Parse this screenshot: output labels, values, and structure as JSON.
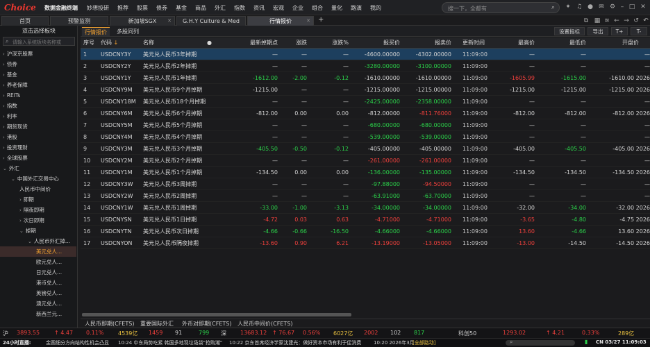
{
  "titlebar": {
    "logo": "Choice",
    "logo_sub": "数据金融终端",
    "menus": [
      "妙想投研",
      "推荐",
      "股票",
      "债券",
      "基金",
      "商品",
      "外汇",
      "指数",
      "资讯",
      "宏观",
      "企业",
      "组合",
      "量化",
      "路演",
      "我的"
    ],
    "search_placeholder": "搜一下，全都有"
  },
  "tabs": [
    {
      "label": "首页"
    },
    {
      "label": "预警监测"
    },
    {
      "label": "新加坡SGX"
    },
    {
      "label": "G.H.Y Culture & Med"
    },
    {
      "label": "行情报价"
    }
  ],
  "sidebar": {
    "title": "双击选择板块",
    "search_placeholder": "请输入系统板块名称或",
    "items": [
      {
        "label": "沪深京股票",
        "level": 0,
        "arrow": "›"
      },
      {
        "label": "债券",
        "level": 0,
        "arrow": "›"
      },
      {
        "label": "基金",
        "level": 0,
        "arrow": "›"
      },
      {
        "label": "养老保障",
        "level": 0,
        "arrow": "›"
      },
      {
        "label": "REITs",
        "level": 0,
        "arrow": "›"
      },
      {
        "label": "指数",
        "level": 0,
        "arrow": "›"
      },
      {
        "label": "利率",
        "level": 0,
        "arrow": "›"
      },
      {
        "label": "期货现货",
        "level": 0,
        "arrow": "›"
      },
      {
        "label": "港股",
        "level": 0,
        "arrow": "›"
      },
      {
        "label": "投资理财",
        "level": 0,
        "arrow": "›"
      },
      {
        "label": "全球股票",
        "level": 0,
        "arrow": "›"
      },
      {
        "label": "外汇",
        "level": 0,
        "arrow": "⌄"
      },
      {
        "label": "中国外汇交易中心",
        "level": 1,
        "arrow": "⌄"
      },
      {
        "label": "人民币中间价",
        "level": 2,
        "arrow": ""
      },
      {
        "label": "即期",
        "level": 2,
        "arrow": "›"
      },
      {
        "label": "隔夜即期",
        "level": 2,
        "arrow": "›"
      },
      {
        "label": "次日即期",
        "level": 2,
        "arrow": "›"
      },
      {
        "label": "掉期",
        "level": 2,
        "arrow": "⌄"
      },
      {
        "label": "人民币外汇掉...",
        "level": 3,
        "arrow": "⌄"
      },
      {
        "label": "美元兑人...",
        "level": 4,
        "arrow": "",
        "selected": true
      },
      {
        "label": "欧元兑人...",
        "level": 4,
        "arrow": ""
      },
      {
        "label": "日元兑人...",
        "level": 4,
        "arrow": ""
      },
      {
        "label": "港币兑人...",
        "level": 4,
        "arrow": ""
      },
      {
        "label": "英镑兑人...",
        "level": 4,
        "arrow": ""
      },
      {
        "label": "澳元兑人...",
        "level": 4,
        "arrow": ""
      },
      {
        "label": "新西兰元...",
        "level": 4,
        "arrow": ""
      }
    ]
  },
  "subtabs": [
    "行情报价",
    "多股同列"
  ],
  "toolbar_buttons": [
    "设置指标",
    "导出",
    "T+",
    "T-"
  ],
  "table": {
    "headers": [
      "序号",
      "代码",
      "名称",
      "",
      "最新掉期点",
      "涨跌",
      "涨跌%",
      "报买价",
      "报卖价",
      "更新时间",
      "最高价",
      "最低价",
      "开盘价"
    ],
    "sort_indicator": "↓",
    "rows": [
      {
        "no": "1",
        "code": "USDCNY3Y",
        "name": "美元兑人民币3年掉期",
        "last": "—",
        "chg": "—",
        "pct": "—",
        "bid": "-4600.00000",
        "ask": "-4302.00000",
        "time": "11:09:00",
        "high": "—",
        "low": "—",
        "open": "—",
        "c_last": "gray",
        "c_chg": "gray",
        "c_bid": "gray",
        "c_ask": "gray",
        "c_high": "gray",
        "c_low": "gray",
        "c_open": "gray"
      },
      {
        "no": "2",
        "code": "USDCNY2Y",
        "name": "美元兑人民币2年掉期",
        "last": "—",
        "chg": "—",
        "pct": "—",
        "bid": "-3280.00000",
        "ask": "-3100.00000",
        "time": "11:09:00",
        "high": "—",
        "low": "—",
        "open": "—",
        "c_last": "gray",
        "c_chg": "gray",
        "c_bid": "green",
        "c_ask": "green",
        "c_high": "gray",
        "c_low": "gray",
        "c_open": "gray"
      },
      {
        "no": "3",
        "code": "USDCNY1Y",
        "name": "美元兑人民币1年掉期",
        "last": "-1612.00",
        "chg": "-2.00",
        "pct": "-0.12",
        "bid": "-1610.00000",
        "ask": "-1610.00000",
        "time": "11:09:00",
        "high": "-1605.99",
        "low": "-1615.00",
        "open": "-1610.00 2026",
        "c_last": "green",
        "c_chg": "green",
        "c_bid": "gray",
        "c_ask": "gray",
        "c_high": "red",
        "c_low": "green",
        "c_open": "gray"
      },
      {
        "no": "4",
        "code": "USDCNY9M",
        "name": "美元兑人民币9个月掉期",
        "last": "-1215.00",
        "chg": "—",
        "pct": "—",
        "bid": "-1215.00000",
        "ask": "-1215.00000",
        "time": "11:09:00",
        "high": "-1215.00",
        "low": "-1215.00",
        "open": "-1215.00 2026",
        "c_last": "gray",
        "c_chg": "gray",
        "c_bid": "gray",
        "c_ask": "gray",
        "c_high": "gray",
        "c_low": "gray",
        "c_open": "gray"
      },
      {
        "no": "5",
        "code": "USDCNY18M",
        "name": "美元兑人民币18个月掉期",
        "last": "—",
        "chg": "—",
        "pct": "—",
        "bid": "-2425.00000",
        "ask": "-2358.00000",
        "time": "11:09:00",
        "high": "—",
        "low": "—",
        "open": "—",
        "c_last": "gray",
        "c_chg": "gray",
        "c_bid": "green",
        "c_ask": "green",
        "c_high": "gray",
        "c_low": "gray",
        "c_open": "gray"
      },
      {
        "no": "6",
        "code": "USDCNY6M",
        "name": "美元兑人民币6个月掉期",
        "last": "-812.00",
        "chg": "0.00",
        "pct": "0.00",
        "bid": "-812.00000",
        "ask": "-811.76000",
        "time": "11:09:00",
        "high": "-812.00",
        "low": "-812.00",
        "open": "-812.00 2026",
        "c_last": "gray",
        "c_chg": "gray",
        "c_bid": "gray",
        "c_ask": "red",
        "c_high": "gray",
        "c_low": "gray",
        "c_open": "gray"
      },
      {
        "no": "7",
        "code": "USDCNY5M",
        "name": "美元兑人民币5个月掉期",
        "last": "—",
        "chg": "—",
        "pct": "—",
        "bid": "-680.00000",
        "ask": "-680.00000",
        "time": "11:09:00",
        "high": "—",
        "low": "—",
        "open": "—",
        "c_last": "gray",
        "c_chg": "gray",
        "c_bid": "green",
        "c_ask": "green",
        "c_high": "gray",
        "c_low": "gray",
        "c_open": "gray"
      },
      {
        "no": "8",
        "code": "USDCNY4M",
        "name": "美元兑人民币4个月掉期",
        "last": "—",
        "chg": "—",
        "pct": "—",
        "bid": "-539.00000",
        "ask": "-539.00000",
        "time": "11:09:00",
        "high": "—",
        "low": "—",
        "open": "—",
        "c_last": "gray",
        "c_chg": "gray",
        "c_bid": "green",
        "c_ask": "green",
        "c_high": "gray",
        "c_low": "gray",
        "c_open": "gray"
      },
      {
        "no": "9",
        "code": "USDCNY3M",
        "name": "美元兑人民币3个月掉期",
        "last": "-405.50",
        "chg": "-0.50",
        "pct": "-0.12",
        "bid": "-405.00000",
        "ask": "-405.00000",
        "time": "11:09:00",
        "high": "-405.00",
        "low": "-405.50",
        "open": "-405.00 2026",
        "c_last": "green",
        "c_chg": "green",
        "c_bid": "gray",
        "c_ask": "gray",
        "c_high": "gray",
        "c_low": "green",
        "c_open": "gray"
      },
      {
        "no": "10",
        "code": "USDCNY2M",
        "name": "美元兑人民币2个月掉期",
        "last": "—",
        "chg": "—",
        "pct": "—",
        "bid": "-261.00000",
        "ask": "-261.00000",
        "time": "11:09:00",
        "high": "—",
        "low": "—",
        "open": "—",
        "c_last": "gray",
        "c_chg": "gray",
        "c_bid": "red",
        "c_ask": "red",
        "c_high": "gray",
        "c_low": "gray",
        "c_open": "gray"
      },
      {
        "no": "11",
        "code": "USDCNY1M",
        "name": "美元兑人民币1个月掉期",
        "last": "-134.50",
        "chg": "0.00",
        "pct": "0.00",
        "bid": "-136.00000",
        "ask": "-135.00000",
        "time": "11:09:00",
        "high": "-134.50",
        "low": "-134.50",
        "open": "-134.50 2026",
        "c_last": "gray",
        "c_chg": "gray",
        "c_bid": "green",
        "c_ask": "green",
        "c_high": "gray",
        "c_low": "gray",
        "c_open": "gray"
      },
      {
        "no": "12",
        "code": "USDCNY3W",
        "name": "美元兑人民币3周掉期",
        "last": "—",
        "chg": "—",
        "pct": "—",
        "bid": "-97.88000",
        "ask": "-94.50000",
        "time": "11:09:00",
        "high": "—",
        "low": "—",
        "open": "—",
        "c_last": "gray",
        "c_chg": "gray",
        "c_bid": "green",
        "c_ask": "red",
        "c_high": "gray",
        "c_low": "gray",
        "c_open": "gray"
      },
      {
        "no": "13",
        "code": "USDCNY2W",
        "name": "美元兑人民币2周掉期",
        "last": "—",
        "chg": "—",
        "pct": "—",
        "bid": "-63.91000",
        "ask": "-63.70000",
        "time": "11:09:00",
        "high": "—",
        "low": "—",
        "open": "—",
        "c_last": "gray",
        "c_chg": "gray",
        "c_bid": "green",
        "c_ask": "green",
        "c_high": "gray",
        "c_low": "gray",
        "c_open": "gray"
      },
      {
        "no": "14",
        "code": "USDCNY1W",
        "name": "美元兑人民币1周掉期",
        "last": "-33.00",
        "chg": "-1.00",
        "pct": "-3.13",
        "bid": "-34.00000",
        "ask": "-34.00000",
        "time": "11:09:00",
        "high": "-32.00",
        "low": "-34.00",
        "open": "-32.00 2026",
        "c_last": "green",
        "c_chg": "green",
        "c_bid": "green",
        "c_ask": "green",
        "c_high": "gray",
        "c_low": "green",
        "c_open": "gray"
      },
      {
        "no": "15",
        "code": "USDCNYSN",
        "name": "美元兑人民币1日掉期",
        "last": "-4.72",
        "chg": "0.03",
        "pct": "0.63",
        "bid": "-4.71000",
        "ask": "-4.71000",
        "time": "11:09:00",
        "high": "-3.65",
        "low": "-4.80",
        "open": "-4.75 2026",
        "c_last": "red",
        "c_chg": "red",
        "c_bid": "red",
        "c_ask": "red",
        "c_high": "red",
        "c_low": "green",
        "c_open": "gray"
      },
      {
        "no": "16",
        "code": "USDCNYTN",
        "name": "美元兑人民币次日掉期",
        "last": "-4.66",
        "chg": "-0.66",
        "pct": "-16.50",
        "bid": "-4.66000",
        "ask": "-4.66000",
        "time": "11:09:00",
        "high": "13.60",
        "low": "-4.66",
        "open": "13.60 2026",
        "c_last": "green",
        "c_chg": "green",
        "c_bid": "green",
        "c_ask": "green",
        "c_high": "red",
        "c_low": "green",
        "c_open": "gray"
      },
      {
        "no": "17",
        "code": "USDCNYON",
        "name": "美元兑人民币隔夜掉期",
        "last": "-13.60",
        "chg": "0.90",
        "pct": "6.21",
        "bid": "-13.19000",
        "ask": "-13.05000",
        "time": "11:09:00",
        "high": "-13.00",
        "low": "-14.50",
        "open": "-14.50 2026",
        "c_last": "red",
        "c_chg": "red",
        "c_bid": "red",
        "c_ask": "red",
        "c_high": "red",
        "c_low": "gray",
        "c_open": "gray"
      }
    ]
  },
  "bottom_tabs": [
    "人民币即期(CFETS)",
    "重要国际外汇",
    "外币对即期(CFETS)",
    "人民币中间价(CFETS)"
  ],
  "index_bar": [
    {
      "text": "沪",
      "color": "#d0d0d0"
    },
    {
      "text": "3893.55",
      "color": "#f0403c"
    },
    {
      "text": "↑ 4.47",
      "color": "#f0403c"
    },
    {
      "text": "0.11%",
      "color": "#f0403c"
    },
    {
      "text": "4539亿",
      "color": "#e8c040"
    },
    {
      "text": "1459",
      "color": "#f0403c"
    },
    {
      "text": "91",
      "color": "#d0d0d0"
    },
    {
      "text": "799",
      "color": "#2bd24a"
    },
    {
      "text": "深",
      "color": "#d0d0d0"
    },
    {
      "text": "13683.12",
      "color": "#f0403c"
    },
    {
      "text": "↑ 76.67",
      "color": "#f0403c"
    },
    {
      "text": "0.56%",
      "color": "#f0403c"
    },
    {
      "text": "6027亿",
      "color": "#e8c040"
    },
    {
      "text": "2002",
      "color": "#f0403c"
    },
    {
      "text": "102",
      "color": "#d0d0d0"
    },
    {
      "text": "817",
      "color": "#2bd24a"
    },
    {
      "text": "科创50",
      "color": "#d0d0d0"
    },
    {
      "text": "1293.02",
      "color": "#f0403c"
    },
    {
      "text": "↑ 4.21",
      "color": "#f0403c"
    },
    {
      "text": "0.33%",
      "color": "#f0403c"
    },
    {
      "text": "289亿",
      "color": "#e8c040"
    }
  ],
  "news_bar": {
    "label": "24小时直播:",
    "items": [
      "金圆细分方向结构性机会凸显",
      "10:24 中东局势吃紧 韩国多地现垃圾袋\"抢购潮\"",
      "10:22 京东首席经济学家沈建光：做好资本市场有利于促消费",
      "10:20 2026年3月",
      "[全部路动]"
    ],
    "clock": "CN 03/27 11:09:03"
  }
}
